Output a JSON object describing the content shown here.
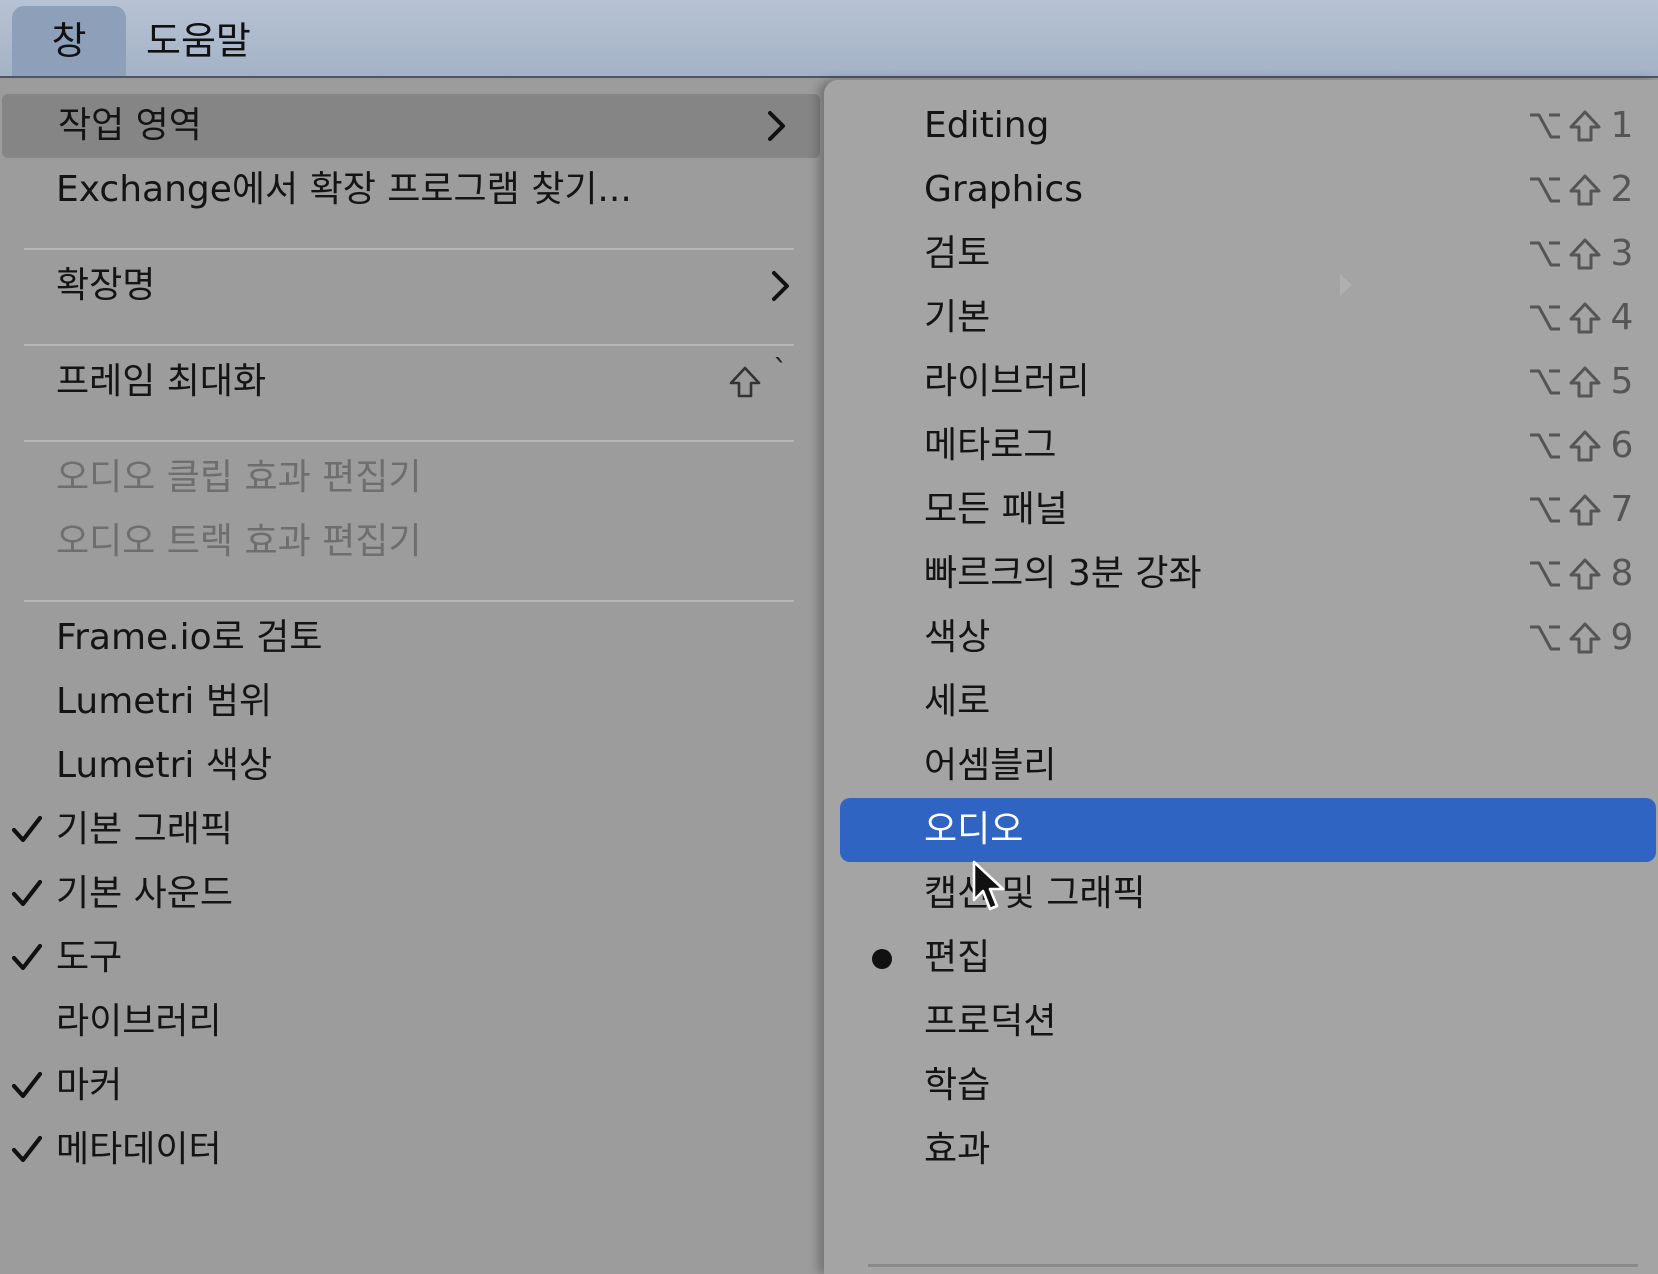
{
  "menubar": {
    "items": [
      {
        "label": "창",
        "active": true
      },
      {
        "label": "도움말",
        "active": false
      }
    ]
  },
  "left_menu": {
    "items": [
      {
        "label": "작업 영역",
        "submenu": true,
        "highlighted": true
      },
      {
        "label": "Exchange에서 확장 프로그램 찾기..."
      },
      {
        "label": "확장명",
        "submenu": true
      },
      {
        "label": "프레임 최대화",
        "shortcut_key": "`"
      },
      {
        "label": "오디오 클립 효과 편집기",
        "disabled": true
      },
      {
        "label": "오디오 트랙 효과 편집기",
        "disabled": true
      },
      {
        "label": "Frame.io로 검토"
      },
      {
        "label": "Lumetri 범위"
      },
      {
        "label": "Lumetri 색상"
      },
      {
        "label": "기본 그래픽",
        "checked": true
      },
      {
        "label": "기본 사운드",
        "checked": true
      },
      {
        "label": "도구",
        "checked": true
      },
      {
        "label": "라이브러리"
      },
      {
        "label": "마커",
        "checked": true
      },
      {
        "label": "메타데이터",
        "checked": true
      }
    ]
  },
  "right_menu": {
    "items": [
      {
        "label": "Editing",
        "shortcut": "1"
      },
      {
        "label": "Graphics",
        "shortcut": "2"
      },
      {
        "label": "검토",
        "shortcut": "3"
      },
      {
        "label": "기본",
        "shortcut": "4"
      },
      {
        "label": "라이브러리",
        "shortcut": "5"
      },
      {
        "label": "메타로그",
        "shortcut": "6"
      },
      {
        "label": "모든 패널",
        "shortcut": "7"
      },
      {
        "label": "빠르크의 3분 강좌",
        "shortcut": "8"
      },
      {
        "label": "색상",
        "shortcut": "9"
      },
      {
        "label": "세로"
      },
      {
        "label": "어셈블리"
      },
      {
        "label": "오디오",
        "selected": true
      },
      {
        "label": "캡션 및 그래픽"
      },
      {
        "label": "편집",
        "current": true
      },
      {
        "label": "프로덕션"
      },
      {
        "label": "학습"
      },
      {
        "label": "효과"
      }
    ]
  },
  "colors": {
    "selection": "#2f64c2",
    "menu_bg": "#9c9c9c",
    "menubar_bg": "#aab7ca"
  },
  "icons": {
    "submenu": "chevron-right-icon",
    "checked": "checkmark-icon",
    "current": "bullet-dot-icon",
    "shortcut_modifiers": [
      "option-key-icon",
      "shift-key-icon"
    ],
    "pointer": "mouse-cursor-icon"
  }
}
